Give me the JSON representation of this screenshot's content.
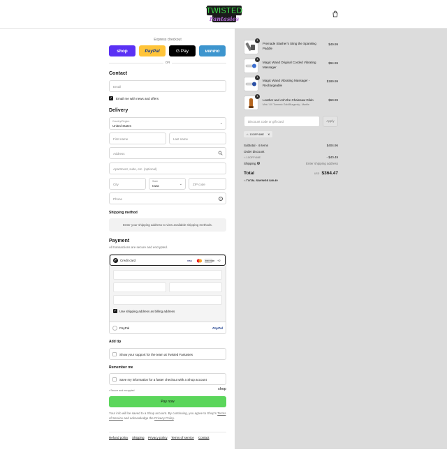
{
  "header": {
    "logo_line1": "TWISTED",
    "logo_line2": "Fantasies",
    "cart_icon": "shopping-bag-icon"
  },
  "express": {
    "title": "Express checkout",
    "buttons": [
      "shop",
      "PayPal",
      "G Pay",
      "venmo"
    ],
    "or": "OR"
  },
  "contact": {
    "heading": "Contact",
    "email_placeholder": "Email",
    "newsletter_label": "Email me with news and offers"
  },
  "delivery": {
    "heading": "Delivery",
    "country_label": "Country/Region",
    "country_value": "United States",
    "first_name": "First name",
    "last_name": "Last name",
    "address": "Address",
    "apartment": "Apartment, suite, etc. (optional)",
    "city": "City",
    "state_label": "State",
    "state_value": "Iowa",
    "zip": "ZIP code",
    "phone": "Phone"
  },
  "shipping": {
    "heading": "Shipping method",
    "notice": "Enter your shipping address to view available shipping methods."
  },
  "payment": {
    "heading": "Payment",
    "subtitle": "All transactions are secure and encrypted.",
    "credit_card_label": "Credit card",
    "card_brands": [
      "VISA",
      "mc",
      "DISCOVER"
    ],
    "more_brands": "+2",
    "billing_label": "Use shipping address as billing address",
    "paypal_label": "PayPal",
    "paypal_logo": "PayPal"
  },
  "tip": {
    "heading": "Add tip",
    "label": "Show your support for the team at Twisted Fantasies"
  },
  "remember": {
    "heading": "Remember me",
    "label": "Save my information for a faster checkout with a Shop account",
    "secure": "Secure and encrypted",
    "shop_logo": "shop"
  },
  "pay_now": "Pay now",
  "legal": {
    "text1": "Your info will be saved to a Shop account. By continuing, you agree to Shop's",
    "terms": "Terms of Service",
    "text2": "and acknowledge the",
    "privacy": "Privacy Policy",
    "end": "."
  },
  "footer_links": [
    "Refund policy",
    "Shipping",
    "Privacy policy",
    "Terms of service",
    "Contact"
  ],
  "order": {
    "items": [
      {
        "name": "Premade Slasher's Sting the Spanking Paddle",
        "price": "$49.99",
        "qty": "1",
        "sub": ""
      },
      {
        "name": "Magic Wand Original Corded Vibrating Massager",
        "price": "$94.99",
        "qty": "1",
        "sub": ""
      },
      {
        "name": "Magic Wand Vibrating Massager - Rechargeable",
        "price": "$189.99",
        "qty": "1",
        "sub": ""
      },
      {
        "name": "Leather and Ash the Chainsaw Dildo",
        "price": "$69.99",
        "qty": "1",
        "sub": "Mini / UV Turmeric Gold/Burgundy - Marble"
      }
    ],
    "discount_placeholder": "Discount code or gift card",
    "apply": "Apply",
    "applied_code": "10OFF4ME",
    "subtotal_label": "Subtotal · 4 items",
    "subtotal_value": "$404.96",
    "order_discount_label": "Order discount",
    "discount_code": "10OFF4ME",
    "discount_value": "- $40.49",
    "shipping_label": "Shipping",
    "shipping_value": "Enter shipping address",
    "total_label": "Total",
    "currency": "USD",
    "total_value": "$364.47",
    "savings_label": "TOTAL SAVINGS",
    "savings_value": "$40.49"
  },
  "colors": {
    "shop": "#5a31f4",
    "paypal": "#ffc439",
    "gpay": "#000000",
    "venmo": "#3d95ce",
    "pay_now": "#5bd65b",
    "summary_bg": "#dcdcdc"
  }
}
